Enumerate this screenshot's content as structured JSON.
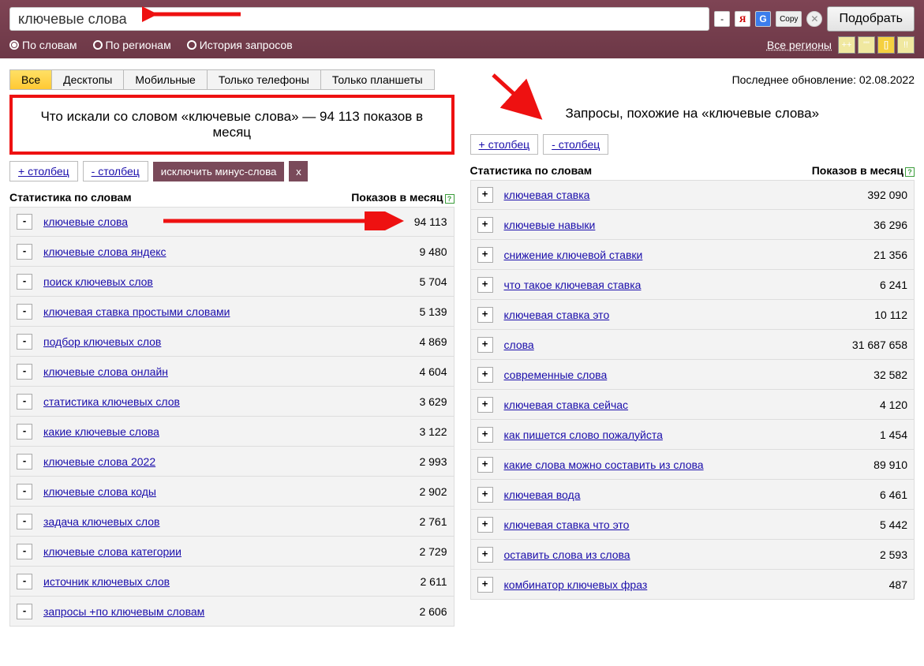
{
  "search": {
    "value": "ключевые слова",
    "submit": "Подобрать",
    "copy": "Copy",
    "yandex": "Я",
    "google": "G",
    "minus": "-",
    "clear": "✕"
  },
  "radios": {
    "by_words": "По словам",
    "by_regions": "По регионам",
    "history": "История запросов"
  },
  "regions_link": "Все регионы",
  "small_btns": [
    "++",
    "\"\"",
    "[]",
    "!!"
  ],
  "tabs": [
    "Все",
    "Десктопы",
    "Мобильные",
    "Только телефоны",
    "Только планшеты"
  ],
  "last_update": "Последнее обновление: 02.08.2022",
  "left": {
    "banner": "Что искали со словом «ключевые слова» — 94 113 показов в месяц",
    "add_col": "+ столбец",
    "rem_col": "- столбец",
    "exclude": "исключить минус-слова",
    "x": "x",
    "header_left": "Статистика по словам",
    "header_right": "Показов в месяц",
    "help": "?",
    "rows": [
      {
        "btn": "-",
        "label": "ключевые слова",
        "val": "94 113"
      },
      {
        "btn": "-",
        "label": "ключевые слова яндекс",
        "val": "9 480"
      },
      {
        "btn": "-",
        "label": "поиск ключевых слов",
        "val": "5 704"
      },
      {
        "btn": "-",
        "label": "ключевая ставка простыми словами",
        "val": "5 139"
      },
      {
        "btn": "-",
        "label": "подбор ключевых слов",
        "val": "4 869"
      },
      {
        "btn": "-",
        "label": "ключевые слова онлайн",
        "val": "4 604"
      },
      {
        "btn": "-",
        "label": "статистика ключевых слов",
        "val": "3 629"
      },
      {
        "btn": "-",
        "label": "какие ключевые слова",
        "val": "3 122"
      },
      {
        "btn": "-",
        "label": "ключевые слова 2022",
        "val": "2 993"
      },
      {
        "btn": "-",
        "label": "ключевые слова коды",
        "val": "2 902"
      },
      {
        "btn": "-",
        "label": "задача ключевых слов",
        "val": "2 761"
      },
      {
        "btn": "-",
        "label": "ключевые слова категории",
        "val": "2 729"
      },
      {
        "btn": "-",
        "label": "источник ключевых слов",
        "val": "2 611"
      },
      {
        "btn": "-",
        "label": "запросы +по ключевым словам",
        "val": "2 606"
      }
    ]
  },
  "right": {
    "title": "Запросы, похожие на «ключевые слова»",
    "add_col": "+ столбец",
    "rem_col": "- столбец",
    "header_left": "Статистика по словам",
    "header_right": "Показов в месяц",
    "help": "?",
    "rows": [
      {
        "btn": "+",
        "label": "ключевая ставка",
        "val": "392 090"
      },
      {
        "btn": "+",
        "label": "ключевые навыки",
        "val": "36 296"
      },
      {
        "btn": "+",
        "label": "снижение ключевой ставки",
        "val": "21 356"
      },
      {
        "btn": "+",
        "label": "что такое ключевая ставка",
        "val": "6 241"
      },
      {
        "btn": "+",
        "label": "ключевая ставка это",
        "val": "10 112"
      },
      {
        "btn": "+",
        "label": "слова",
        "val": "31 687 658"
      },
      {
        "btn": "+",
        "label": "современные слова",
        "val": "32 582"
      },
      {
        "btn": "+",
        "label": "ключевая ставка сейчас",
        "val": "4 120"
      },
      {
        "btn": "+",
        "label": "как пишется слово пожалуйста",
        "val": "1 454"
      },
      {
        "btn": "+",
        "label": "какие слова можно составить из слова",
        "val": "89 910"
      },
      {
        "btn": "+",
        "label": "ключевая вода",
        "val": "6 461"
      },
      {
        "btn": "+",
        "label": "ключевая ставка что это",
        "val": "5 442"
      },
      {
        "btn": "+",
        "label": "оставить слова из слова",
        "val": "2 593"
      },
      {
        "btn": "+",
        "label": "комбинатор ключевых фраз",
        "val": "487"
      }
    ]
  }
}
